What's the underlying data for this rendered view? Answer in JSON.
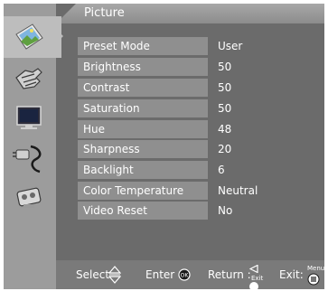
{
  "header": {
    "title": "Picture"
  },
  "sidebar": {
    "items": [
      {
        "name": "picture",
        "icon": "picture-icon",
        "selected": true
      },
      {
        "name": "hand",
        "icon": "hand-icon"
      },
      {
        "name": "monitor",
        "icon": "monitor-icon"
      },
      {
        "name": "cable",
        "icon": "cable-icon"
      },
      {
        "name": "tools",
        "icon": "tools-icon"
      }
    ]
  },
  "menu": {
    "items": [
      {
        "label": "Preset Mode",
        "value": "User"
      },
      {
        "label": "Brightness",
        "value": "50"
      },
      {
        "label": "Contrast",
        "value": "50"
      },
      {
        "label": "Saturation",
        "value": "50"
      },
      {
        "label": "Hue",
        "value": "48"
      },
      {
        "label": "Sharpness",
        "value": "20"
      },
      {
        "label": "Backlight",
        "value": "6"
      },
      {
        "label": "Color Temperature",
        "value": "Neutral"
      },
      {
        "label": "Video Reset",
        "value": "No"
      }
    ]
  },
  "footer": {
    "select_label": "Select",
    "enter_label": "Enter",
    "ok_text": "OK",
    "return_label": "Return :",
    "exit_small": "Exit",
    "exit_label": "Exit:",
    "menu_small": "Menu"
  },
  "colors": {
    "panel": "#6b6b6b",
    "sidebar": "#9c9c9c",
    "row": "#8f8f8f",
    "highlight": "#bdbdbd",
    "text": "#ffffff"
  }
}
